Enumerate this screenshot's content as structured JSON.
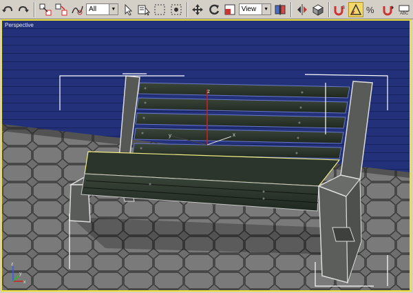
{
  "toolbar": {
    "selection_filter": "All",
    "reference_coord": "View",
    "buttons": [
      {
        "name": "undo-icon"
      },
      {
        "name": "redo-icon"
      },
      {
        "name": "select-and-link-icon"
      },
      {
        "name": "unlink-selection-icon"
      },
      {
        "name": "bind-to-space-warp-icon"
      },
      {
        "name": "select-object-icon"
      },
      {
        "name": "select-by-name-icon"
      },
      {
        "name": "rectangular-selection-icon"
      },
      {
        "name": "window-crossing-icon"
      },
      {
        "name": "select-and-move-icon"
      },
      {
        "name": "select-and-rotate-icon"
      },
      {
        "name": "select-and-scale-icon"
      },
      {
        "name": "use-pivot-center-icon"
      },
      {
        "name": "mirror-icon"
      },
      {
        "name": "align-icon"
      },
      {
        "name": "snap-3d-icon"
      },
      {
        "name": "angle-snap-icon"
      },
      {
        "name": "percent-snap-icon"
      },
      {
        "name": "spinner-snap-icon"
      },
      {
        "name": "named-selection-abc-icon"
      }
    ]
  },
  "viewport": {
    "label": "Perspective",
    "active_border_color": "#f0e03a",
    "gizmo": {
      "x_label": "x",
      "y_label": "y",
      "z_label": "z"
    },
    "axis_tripod": {
      "x_label": "x",
      "y_label": "y",
      "z_label": "z"
    }
  },
  "colors": {
    "ui_gray": "#d4d0c8",
    "wall_blue": "#1f2f78",
    "ground": "#6a6a6a",
    "wood": "#2f3a2f",
    "concrete": "#5e605e"
  }
}
